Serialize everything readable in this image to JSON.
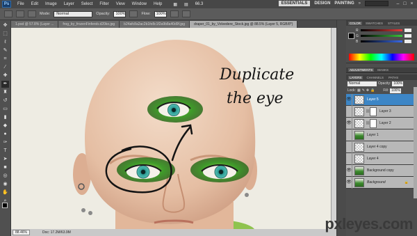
{
  "menubar": {
    "logo": "Ps",
    "items": [
      "File",
      "Edit",
      "Image",
      "Layer",
      "Select",
      "Filter",
      "View",
      "Window",
      "Help"
    ],
    "zoom_value": "66.3",
    "workspaces": [
      "ESSENTIALS",
      "DESIGN",
      "PAINTING"
    ],
    "more_chevron": "»"
  },
  "options": {
    "mode_label": "Mode:",
    "mode_value": "Normal",
    "opacity_label": "Opacity:",
    "opacity_value": "100%",
    "flow_label": "Flow:",
    "flow_value": "100%"
  },
  "tabs": [
    {
      "label": "1.psd @ 57.8% (Layer ...",
      "active": false
    },
    {
      "label": "frog_by_frozenFinferob.d20ko.jpg",
      "active": false
    },
    {
      "label": "b24afc8a2ac2b1fe8c1f2a9b8a40d9f.jpg",
      "active": false
    },
    {
      "label": "draper_01_by_Volvedere_Stock.jpg @ 88.5% (Layer 5, RGB/8*)",
      "active": true
    }
  ],
  "canvas": {
    "annotation_line1": "Duplicate",
    "annotation_line2": "the eye"
  },
  "status": {
    "zoom": "88.46%",
    "doc": "Doc: 17.2M/63.9M"
  },
  "color_panel": {
    "tabs": [
      "COLOR",
      "SWATCHES",
      "STYLES"
    ],
    "sliders": [
      {
        "letter": "R",
        "color": "#e83a3a"
      },
      {
        "letter": "G",
        "color": "#3ac43a"
      },
      {
        "letter": "B",
        "color": "#3a6ae8"
      }
    ]
  },
  "adjust_panel": {
    "tabs": [
      "ADJUSTMENTS",
      "MASKS"
    ]
  },
  "layers_panel": {
    "tabs": [
      "LAYERS",
      "CHANNELS",
      "PATHS"
    ],
    "blend_mode": "Normal",
    "opacity_label": "Opacity:",
    "opacity_value": "100%",
    "lock_label": "Lock:",
    "fill_label": "Fill:",
    "fill_value": "100%",
    "layers": [
      {
        "name": "Layer 5",
        "visible": true,
        "active": true,
        "mask": false,
        "photo": false,
        "italic": false,
        "locked": false
      },
      {
        "name": "Layer 3",
        "visible": false,
        "active": false,
        "mask": true,
        "photo": false,
        "italic": false,
        "locked": false
      },
      {
        "name": "Layer 2",
        "visible": true,
        "active": false,
        "mask": true,
        "photo": false,
        "italic": false,
        "locked": false
      },
      {
        "name": "Layer 1",
        "visible": false,
        "active": false,
        "mask": false,
        "photo": true,
        "italic": false,
        "locked": false
      },
      {
        "name": "Layer 4 copy",
        "visible": false,
        "active": false,
        "mask": false,
        "photo": false,
        "italic": false,
        "locked": false
      },
      {
        "name": "Layer 4",
        "visible": false,
        "active": false,
        "mask": false,
        "photo": false,
        "italic": false,
        "locked": false
      },
      {
        "name": "Background copy",
        "visible": true,
        "active": false,
        "mask": false,
        "photo": true,
        "italic": false,
        "locked": false
      },
      {
        "name": "Background",
        "visible": true,
        "active": false,
        "mask": false,
        "photo": true,
        "italic": true,
        "locked": true
      }
    ]
  },
  "watermark": "pxleyes.com",
  "colors": {
    "accent_selected": "#3d86c6",
    "eyeshadow": "#3f9a2a",
    "iris": "#3aa6a0"
  }
}
